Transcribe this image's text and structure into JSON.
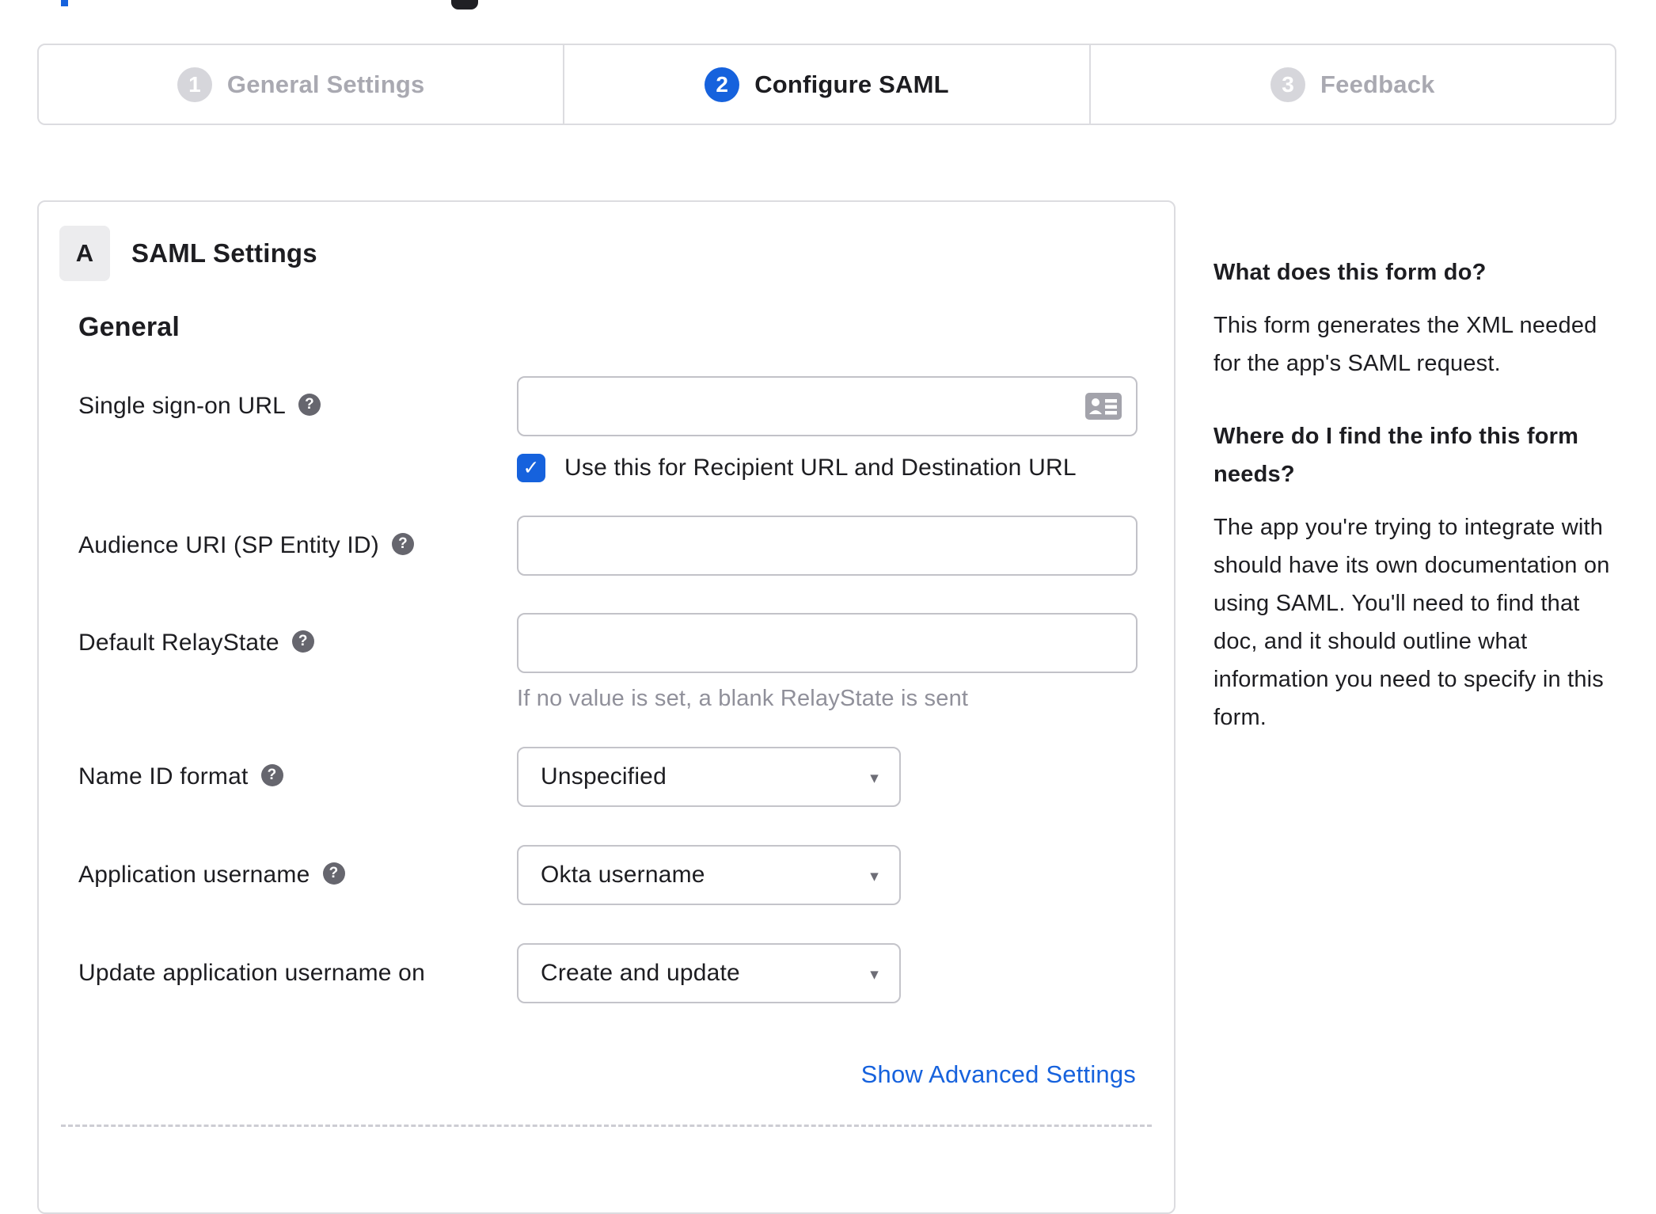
{
  "stepper": {
    "steps": [
      {
        "number": "1",
        "label": "General Settings",
        "state": "inactive"
      },
      {
        "number": "2",
        "label": "Configure SAML",
        "state": "active"
      },
      {
        "number": "3",
        "label": "Feedback",
        "state": "inactive"
      }
    ]
  },
  "panel": {
    "badge": "A",
    "title": "SAML Settings",
    "section": "General",
    "fields": {
      "sso_url": {
        "label": "Single sign-on URL",
        "value": "",
        "checkbox_label": "Use this for Recipient URL and Destination URL",
        "checkbox_checked": true
      },
      "audience_uri": {
        "label": "Audience URI (SP Entity ID)",
        "value": ""
      },
      "default_relaystate": {
        "label": "Default RelayState",
        "value": "",
        "hint": "If no value is set, a blank RelayState is sent"
      },
      "name_id_format": {
        "label": "Name ID format",
        "value": "Unspecified"
      },
      "application_username": {
        "label": "Application username",
        "value": "Okta username"
      },
      "update_app_username_on": {
        "label": "Update application username on",
        "value": "Create and update"
      }
    },
    "advanced_link": "Show Advanced Settings"
  },
  "sidebar": {
    "heading1": "What does this form do?",
    "paragraph1": "This form generates the XML needed\nfor the app's SAML request.",
    "heading2": "Where do I find the info this form\nneeds?",
    "paragraph2": "The app you're trying to integrate with\nshould have its own documentation on\nusing SAML. You'll need to find that\ndoc, and it should outline what\ninformation you need to specify in this\nform."
  },
  "icons": {
    "help_glyph": "?",
    "check_glyph": "✓",
    "caret_glyph": "▾"
  },
  "colors": {
    "accent_blue": "#1662dd",
    "text_dark": "#1d1d21",
    "inactive_gray": "#a9a9b1",
    "hint_gray": "#90909a"
  }
}
